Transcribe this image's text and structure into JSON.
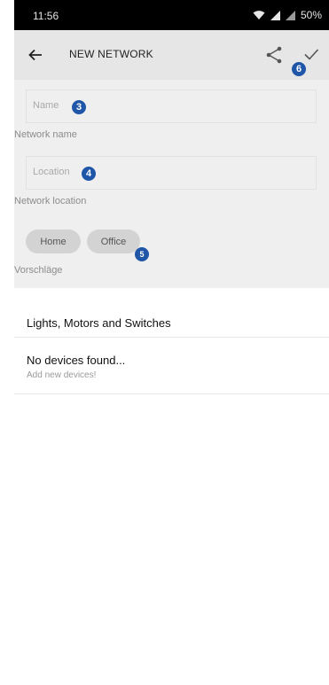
{
  "status_bar": {
    "time": "11:56",
    "battery": "50%"
  },
  "toolbar": {
    "title": "NEW NETWORK",
    "back_icon": "arrow-left-icon",
    "share_icon": "share-icon",
    "confirm_icon": "check-icon",
    "confirm_badge": "6"
  },
  "form": {
    "name_placeholder": "Name",
    "name_badge": "3",
    "name_helper": "Network name",
    "location_placeholder": "Location",
    "location_badge": "4",
    "location_helper": "Network location",
    "suggestions": [
      "Home",
      "Office"
    ],
    "suggestions_badge": "5",
    "suggestions_helper": "Vorschläge"
  },
  "devices": {
    "section_title": "Lights, Motors and Switches",
    "empty_title": "No devices found...",
    "empty_subtitle": "Add new devices!"
  },
  "colors": {
    "badge": "#1f56a8",
    "panel": "#efefef",
    "toolbar": "#e6e6e6",
    "chip": "#d3d3d3"
  }
}
